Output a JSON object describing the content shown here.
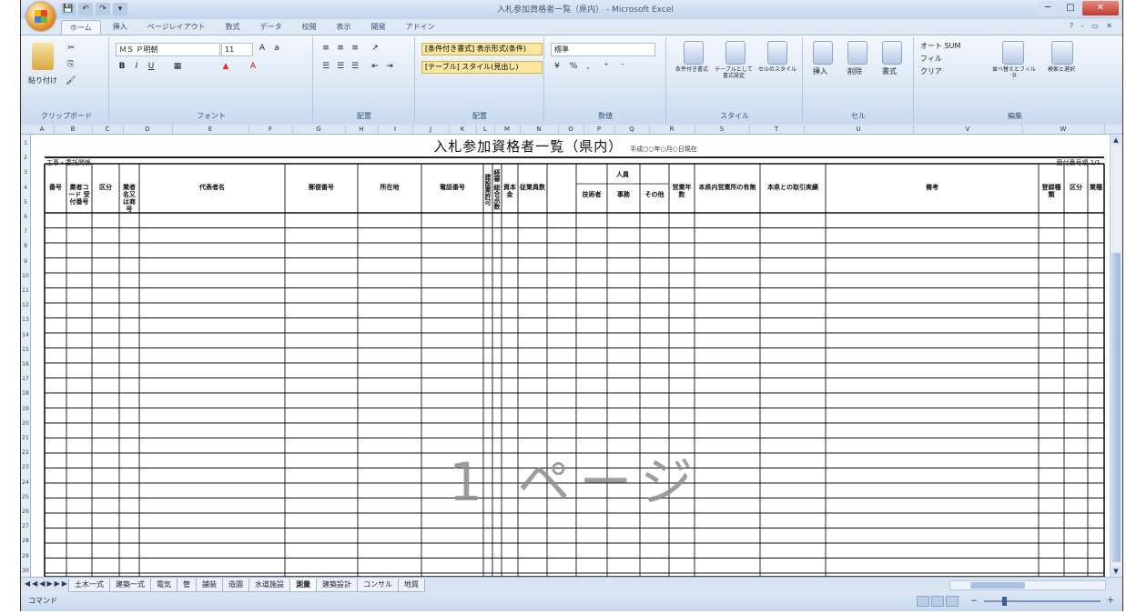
{
  "window": {
    "title": "入札参加資格者一覧（県内） - Microsoft Excel",
    "controls": [
      "─",
      "□",
      "✕"
    ]
  },
  "quick_access": [
    "💾",
    "↶",
    "↷",
    "▾"
  ],
  "ribbon": {
    "tabs": [
      "ホーム",
      "挿入",
      "ページレイアウト",
      "数式",
      "データ",
      "校閲",
      "表示",
      "開発",
      "アドイン"
    ],
    "active_tab": "ホーム",
    "tab_right": "? - ▭ ✕",
    "clipboard": {
      "paste": "貼り付け",
      "label": "クリップボード"
    },
    "font": {
      "name": "ＭＳ Ｐ明朝",
      "size": "11",
      "label": "フォント",
      "bold": "B",
      "italic": "I",
      "underline": "U"
    },
    "alignment": {
      "label": "配置"
    },
    "styles_box": {
      "cond1": "[条件付き書式] 表示形式(条件)",
      "cond2": "[テーブル] スタイル(見出し)",
      "label": "配置"
    },
    "number": {
      "format": "標準",
      "label": "数値",
      "percent": "%",
      "comma": ","
    },
    "styles": {
      "label": "スタイル",
      "items": [
        "条件付き書式",
        "テーブルとして書式設定",
        "セルのスタイル"
      ]
    },
    "cells": {
      "label": "セル",
      "items": [
        "挿入",
        "削除",
        "書式"
      ]
    },
    "editing": {
      "label": "編集",
      "items": [
        "オート SUM",
        "フィル",
        "クリア",
        "並べ替えとフィルタ",
        "検索と選択"
      ]
    }
  },
  "sheet": {
    "title": "入札参加資格者一覧（県内）",
    "title_note": "平成○○年○月○日現在",
    "left_note": "工事・委託関係",
    "right_note": "受付番号順 1/1",
    "headers": [
      "番号",
      "業者コード 受付番号",
      "区分",
      "業者名又は商号",
      "代表者名",
      "郵便番号",
      "所在地",
      "電話番号",
      "建設業許可",
      "経審 総合点数",
      "資本金",
      "従業員数",
      "技術者",
      "事務",
      "その他",
      "営業年数",
      "本県内営業所の有無",
      "本県との取引実績",
      "備考",
      "登録種類",
      "区分",
      "業種"
    ],
    "merged_header": "人員",
    "row_numbers": [
      "1",
      "2",
      "3",
      "4",
      "5",
      "6",
      "7",
      "8",
      "9",
      "10",
      "11",
      "12",
      "13",
      "14",
      "15",
      "16",
      "17",
      "18",
      "19",
      "20",
      "21",
      "22",
      "23",
      "24",
      "25",
      "26",
      "27",
      "28",
      "29",
      "30"
    ],
    "watermark": "1 ページ"
  },
  "sheet_tabs": [
    "土木一式",
    "建築一式",
    "電気",
    "管",
    "舗装",
    "造園",
    "水道施設",
    "測量",
    "建築設計",
    "コンサル",
    "地質"
  ],
  "active_sheet_tab": "測量",
  "status": {
    "text": "コマンド",
    "zoom_percent": 40
  }
}
